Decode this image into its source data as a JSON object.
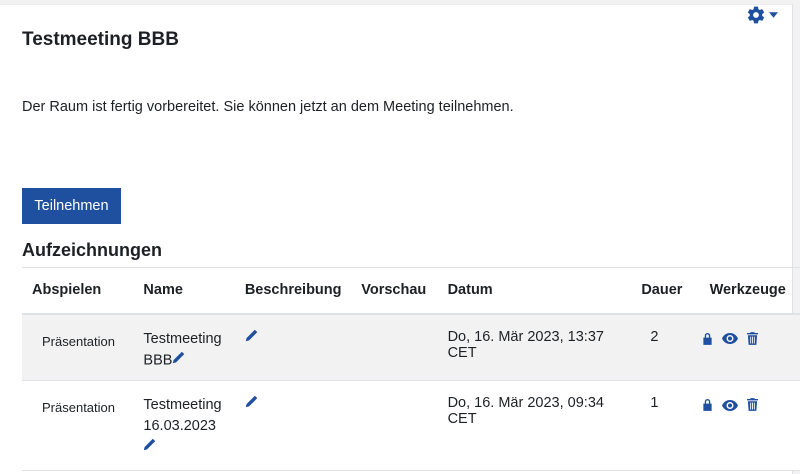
{
  "page": {
    "title": "Testmeeting BBB",
    "status": "Der Raum ist fertig vorbereitet. Sie können jetzt an dem Meeting teilnehmen.",
    "join_label": "Teilnehmen"
  },
  "recordings": {
    "title": "Aufzeichnungen",
    "headers": {
      "play": "Abspielen",
      "name": "Name",
      "description": "Beschreibung",
      "preview": "Vorschau",
      "date": "Datum",
      "duration": "Dauer",
      "tools": "Werkzeuge"
    },
    "rows": [
      {
        "play": "Präsentation",
        "name_line1": "Testmeeting",
        "name_line2": "BBB",
        "date": "Do, 16. Mär 2023, 13:37 CET",
        "duration": "2"
      },
      {
        "play": "Präsentation",
        "name_line1": "Testmeeting",
        "name_line2": "16.03.2023",
        "date": "Do, 16. Mär 2023, 09:34 CET",
        "duration": "1"
      }
    ]
  },
  "colors": {
    "primary": "#1f4f9f",
    "icon": "#1f4f9f",
    "row_shade": "#f2f2f2",
    "border": "#dee2e6"
  },
  "icons": [
    "gear-icon",
    "caret-down-icon",
    "pencil-icon",
    "lock-icon",
    "eye-icon",
    "trash-icon"
  ]
}
